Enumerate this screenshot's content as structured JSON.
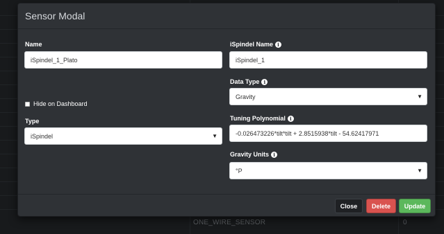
{
  "background": {
    "cell_text": "ONE_WIRE_SENSOR",
    "cell_value": "0"
  },
  "modal": {
    "title": "Sensor Modal",
    "left": {
      "name_label": "Name",
      "name_value": "iSpindel_1_Plato",
      "hide_label": "Hide on Dashboard",
      "hide_checked": false,
      "type_label": "Type",
      "type_value": "iSpindel"
    },
    "right": {
      "ispindel_name_label": "iSpindel Name",
      "ispindel_name_value": "iSpindel_1",
      "data_type_label": "Data Type",
      "data_type_value": "Gravity",
      "tuning_label": "Tuning Polynomial",
      "tuning_value": "-0.026473226*tilt*tilt + 2.8515938*tilt - 54.62417971",
      "gravity_units_label": "Gravity Units",
      "gravity_units_value": "°P"
    },
    "footer": {
      "close_label": "Close",
      "delete_label": "Delete",
      "update_label": "Update"
    },
    "colors": {
      "delete": "#d9534f",
      "update": "#5cb85c",
      "close": "#1f2124"
    }
  }
}
